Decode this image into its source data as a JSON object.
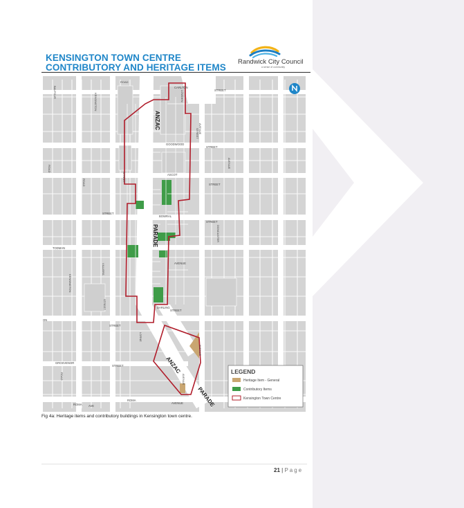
{
  "page": {
    "title_line1": "KENSINGTON TOWN CENTRE",
    "title_line2": "CONTRIBUTORY AND HERITAGE ITEMS",
    "logo_text": "Randwick City Council",
    "logo_tagline": "a sense of community",
    "caption": "Fig 4a: Heritage items and contributory buildings in Kensington town centre.",
    "page_number": "21",
    "page_separator": " | ",
    "page_word": "Page"
  },
  "colors": {
    "title_blue": "#1f86c8",
    "heritage_tan": "#c9a671",
    "contributory_green": "#3f9c48",
    "town_centre_outline": "#b01c2a",
    "north_arrow_blue": "#1f86c8"
  },
  "map": {
    "north_symbol": "N",
    "street_labels": {
      "anzac_top": "ANZAC",
      "parade_mid": "PARADE",
      "anzac_lower": "ANZAC",
      "parade_lower": "PARADE",
      "carlton": "CARLTON",
      "street_carlton": "STREET",
      "goodwood": "GOODWOOD",
      "street_goodwood": "STREET",
      "ascot": "ASCOT",
      "street_ascot": "STREET",
      "bowral": "BOWRAL",
      "street_bowral": "STREET",
      "avenue_bowral_east": "AVENUE",
      "darling": "DARLING",
      "street_darling": "STREET",
      "todman": "TODMAN",
      "street_west1": "STREET",
      "street_west2": "STREET",
      "grosvenor": "GROSVENOR",
      "street_grosvenor": "STREET",
      "roma": "ROMA",
      "ave_roma": "AVE",
      "roma2": "ROMA",
      "avenue_roma2": "AVENUE",
      "kensington_vert": "KENSINGTON",
      "kensington_vert2": "KENSINGTON",
      "road_left": "ROAD",
      "road_left2": "ROAD",
      "road_left3": "ROAD",
      "street_vert_a": "STREET",
      "street_vert_b": "STREET",
      "avenue_vert": "AVENUE",
      "doncaster": "DONCASTER",
      "avenue_doncaster": "AVENUE",
      "lorne": "LORNE",
      "villiers": "VILLIERS",
      "lowden": "LOWDEN",
      "street_lowden": "STREET",
      "in_left": "ON",
      "balfour": "BALFOUR",
      "street_top_left": "ROAD",
      "avenue_lower": "AVENUE",
      "avenue_lower2": "AVENUE"
    },
    "legend": {
      "title": "LEGEND",
      "items": [
        {
          "label": "Heritage Item - General",
          "swatch": "heritage"
        },
        {
          "label": "Contributory Items",
          "swatch": "contributory"
        },
        {
          "label": "Kensington Town Centre",
          "swatch": "outline"
        }
      ]
    }
  }
}
